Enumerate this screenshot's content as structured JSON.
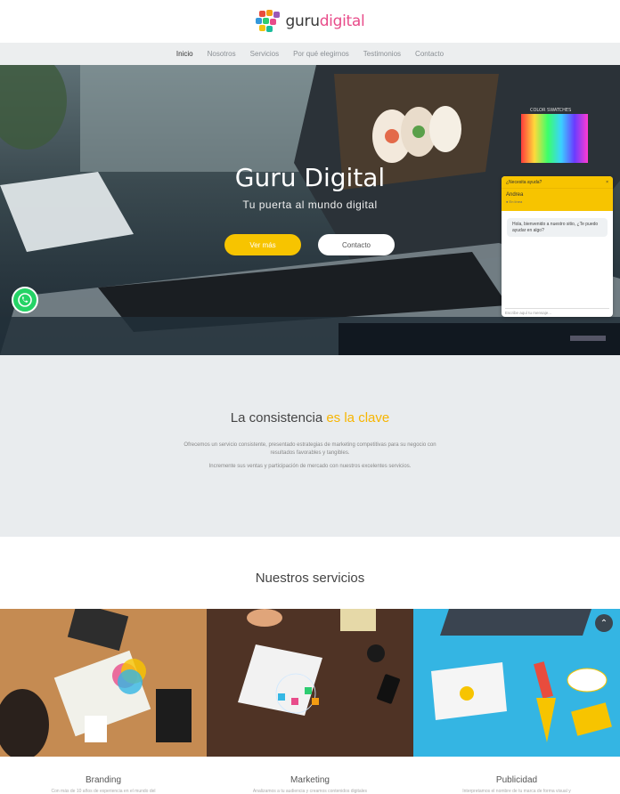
{
  "logo": {
    "part1": "guru",
    "part2": "digital"
  },
  "nav": {
    "items": [
      {
        "label": "Inicio",
        "active": true
      },
      {
        "label": "Nosotros"
      },
      {
        "label": "Servicios"
      },
      {
        "label": "Por qué elegirnos"
      },
      {
        "label": "Testimonios"
      },
      {
        "label": "Contacto"
      }
    ]
  },
  "hero": {
    "title": "Guru Digital",
    "subtitle": "Tu puerta al mundo digital",
    "primary_button": "Ver más",
    "secondary_button": "Contacto",
    "screen_text": "COLOR SWATCHES"
  },
  "chat": {
    "header": "¿Necesita ayuda?",
    "close": "×",
    "agent_name": "Andrea",
    "agent_meta": "● En línea",
    "message": "Hola, bienvenido a nuestro sitio, ¿Te puedo ayudar en algo?",
    "input_placeholder": "Escribe aquí tu mensaje..."
  },
  "consistency": {
    "title_main": "La consistencia ",
    "title_accent": "es la clave",
    "paragraph1": "Ofrecemos un servicio consistente, presentado estrategias de marketing competitivas para su negocio con resultados favorables y tangibles.",
    "paragraph2": "Incremente sus ventas y participación de mercado con nuestros excelentes servicios."
  },
  "services": {
    "title": "Nuestros servicios",
    "items": [
      {
        "name": "Branding",
        "desc": "Con más de 10 años de experiencia en el mundo del"
      },
      {
        "name": "Marketing",
        "desc": "Analizamos a tu audiencia y creamos contenidos digitales"
      },
      {
        "name": "Publicidad",
        "desc": "Interpretamos el nombre de tu marca de forma visual y"
      }
    ]
  },
  "colors": {
    "accent": "#f7c400",
    "brand_pink": "#e84c8a",
    "whatsapp": "#25d366"
  }
}
